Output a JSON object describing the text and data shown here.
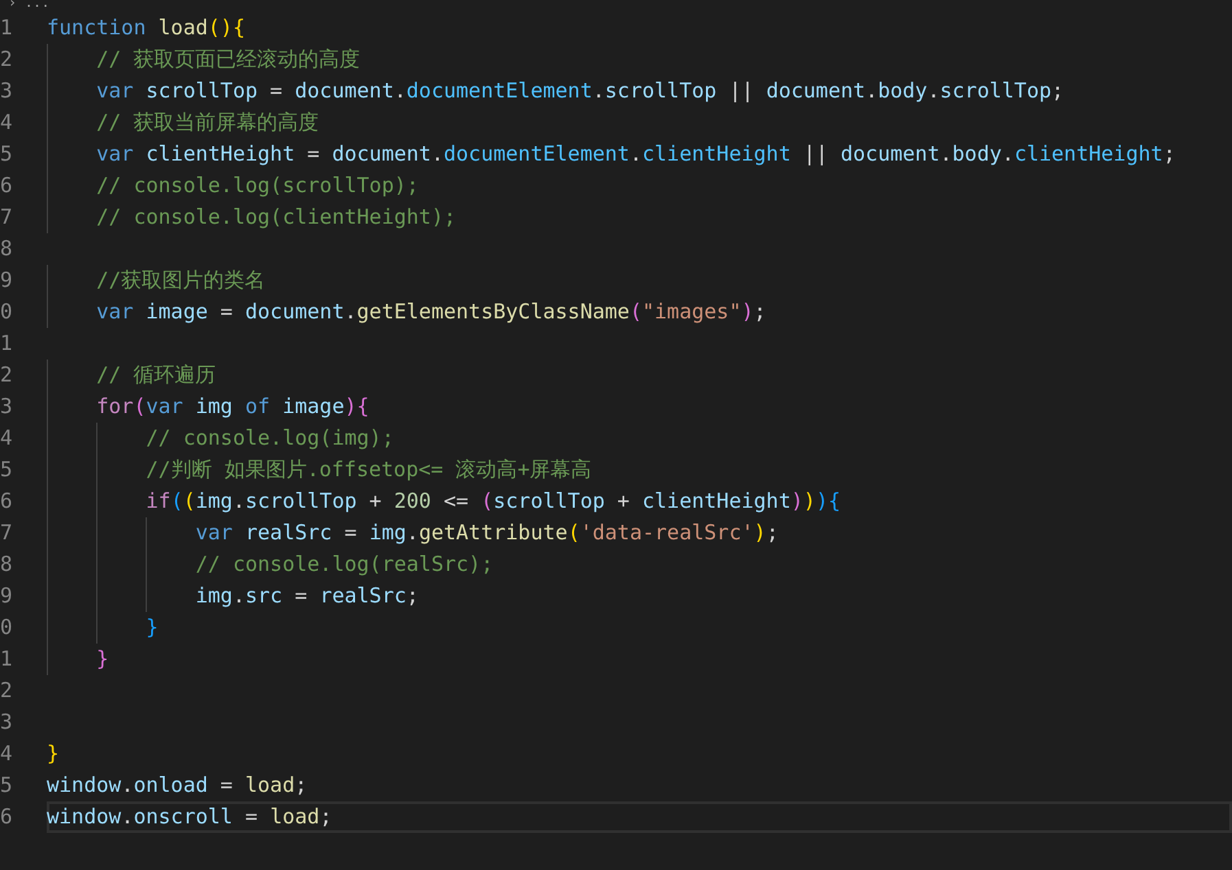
{
  "breadcrumb": "› ...",
  "lines": [
    {
      "number": "1",
      "current": false,
      "tokens": [
        {
          "kind": "kw",
          "text": "function "
        },
        {
          "kind": "fn",
          "text": "load"
        },
        {
          "kind": "b1",
          "text": "(){"
        }
      ]
    },
    {
      "number": "2",
      "current": false,
      "tokens": [
        {
          "kind": "comment",
          "text": "    // 获取页面已经滚动的高度"
        }
      ]
    },
    {
      "number": "3",
      "current": false,
      "tokens": [
        {
          "kind": "kw",
          "text": "    var "
        },
        {
          "kind": "var",
          "text": "scrollTop"
        },
        {
          "kind": "op",
          "text": " = "
        },
        {
          "kind": "var",
          "text": "document"
        },
        {
          "kind": "op",
          "text": "."
        },
        {
          "kind": "const",
          "text": "documentElement"
        },
        {
          "kind": "op",
          "text": "."
        },
        {
          "kind": "var",
          "text": "scrollTop"
        },
        {
          "kind": "op",
          "text": " || "
        },
        {
          "kind": "var",
          "text": "document"
        },
        {
          "kind": "op",
          "text": "."
        },
        {
          "kind": "var",
          "text": "body"
        },
        {
          "kind": "op",
          "text": "."
        },
        {
          "kind": "var",
          "text": "scrollTop"
        },
        {
          "kind": "op",
          "text": ";"
        }
      ]
    },
    {
      "number": "4",
      "current": false,
      "tokens": [
        {
          "kind": "comment",
          "text": "    // 获取当前屏幕的高度"
        }
      ]
    },
    {
      "number": "5",
      "current": false,
      "tokens": [
        {
          "kind": "kw",
          "text": "    var "
        },
        {
          "kind": "var",
          "text": "clientHeight"
        },
        {
          "kind": "op",
          "text": " = "
        },
        {
          "kind": "var",
          "text": "document"
        },
        {
          "kind": "op",
          "text": "."
        },
        {
          "kind": "const",
          "text": "documentElement"
        },
        {
          "kind": "op",
          "text": "."
        },
        {
          "kind": "const",
          "text": "clientHeight"
        },
        {
          "kind": "op",
          "text": " || "
        },
        {
          "kind": "var",
          "text": "document"
        },
        {
          "kind": "op",
          "text": "."
        },
        {
          "kind": "var",
          "text": "body"
        },
        {
          "kind": "op",
          "text": "."
        },
        {
          "kind": "const",
          "text": "clientHeight"
        },
        {
          "kind": "op",
          "text": ";"
        }
      ]
    },
    {
      "number": "6",
      "current": false,
      "tokens": [
        {
          "kind": "comment",
          "text": "    // console.log(scrollTop);"
        }
      ]
    },
    {
      "number": "7",
      "current": false,
      "tokens": [
        {
          "kind": "comment",
          "text": "    // console.log(clientHeight);"
        }
      ]
    },
    {
      "number": "8",
      "current": false
    },
    {
      "number": "9",
      "current": false,
      "tokens": [
        {
          "kind": "comment",
          "text": "    //获取图片的类名"
        }
      ]
    },
    {
      "number": "0",
      "current": false,
      "tokens": [
        {
          "kind": "kw",
          "text": "    var "
        },
        {
          "kind": "var",
          "text": "image"
        },
        {
          "kind": "op",
          "text": " = "
        },
        {
          "kind": "var",
          "text": "document"
        },
        {
          "kind": "op",
          "text": "."
        },
        {
          "kind": "fn",
          "text": "getElementsByClassName"
        },
        {
          "kind": "b2",
          "text": "("
        },
        {
          "kind": "str",
          "text": "\"images\""
        },
        {
          "kind": "b2",
          "text": ")"
        },
        {
          "kind": "op",
          "text": ";"
        }
      ]
    },
    {
      "number": "1",
      "current": false
    },
    {
      "number": "2",
      "current": false,
      "tokens": [
        {
          "kind": "comment",
          "text": "    // 循环遍历"
        }
      ]
    },
    {
      "number": "3",
      "current": false,
      "tokens": [
        {
          "kind": "ctrl",
          "text": "    for"
        },
        {
          "kind": "b2",
          "text": "("
        },
        {
          "kind": "kw",
          "text": "var "
        },
        {
          "kind": "var",
          "text": "img "
        },
        {
          "kind": "kw",
          "text": "of "
        },
        {
          "kind": "var",
          "text": "image"
        },
        {
          "kind": "b2",
          "text": "){"
        }
      ]
    },
    {
      "number": "4",
      "current": false,
      "tokens": [
        {
          "kind": "comment",
          "text": "        // console.log(img);"
        }
      ]
    },
    {
      "number": "5",
      "current": false,
      "tokens": [
        {
          "kind": "comment",
          "text": "        //判断 如果图片.offsetop<= 滚动高+屏幕高"
        }
      ]
    },
    {
      "number": "6",
      "current": false,
      "tokens": [
        {
          "kind": "ctrl",
          "text": "        if"
        },
        {
          "kind": "b3",
          "text": "("
        },
        {
          "kind": "b1",
          "text": "("
        },
        {
          "kind": "var",
          "text": "img"
        },
        {
          "kind": "op",
          "text": "."
        },
        {
          "kind": "var",
          "text": "scrollTop"
        },
        {
          "kind": "op",
          "text": " + "
        },
        {
          "kind": "num",
          "text": "200"
        },
        {
          "kind": "op",
          "text": " <= "
        },
        {
          "kind": "b2",
          "text": "("
        },
        {
          "kind": "var",
          "text": "scrollTop"
        },
        {
          "kind": "op",
          "text": " + "
        },
        {
          "kind": "var",
          "text": "clientHeight"
        },
        {
          "kind": "b2",
          "text": ")"
        },
        {
          "kind": "b1",
          "text": ")"
        },
        {
          "kind": "b3",
          "text": "){"
        }
      ]
    },
    {
      "number": "7",
      "current": false,
      "tokens": [
        {
          "kind": "kw",
          "text": "            var "
        },
        {
          "kind": "var",
          "text": "realSrc"
        },
        {
          "kind": "op",
          "text": " = "
        },
        {
          "kind": "var",
          "text": "img"
        },
        {
          "kind": "op",
          "text": "."
        },
        {
          "kind": "fn",
          "text": "getAttribute"
        },
        {
          "kind": "b1",
          "text": "("
        },
        {
          "kind": "str",
          "text": "'data-realSrc'"
        },
        {
          "kind": "b1",
          "text": ")"
        },
        {
          "kind": "op",
          "text": ";"
        }
      ]
    },
    {
      "number": "8",
      "current": false,
      "tokens": [
        {
          "kind": "comment",
          "text": "            // console.log(realSrc);"
        }
      ]
    },
    {
      "number": "9",
      "current": false,
      "tokens": [
        {
          "kind": "var",
          "text": "            img"
        },
        {
          "kind": "op",
          "text": "."
        },
        {
          "kind": "var",
          "text": "src"
        },
        {
          "kind": "op",
          "text": " = "
        },
        {
          "kind": "var",
          "text": "realSrc"
        },
        {
          "kind": "op",
          "text": ";"
        }
      ]
    },
    {
      "number": "0",
      "current": false,
      "tokens": [
        {
          "kind": "b3",
          "text": "        }"
        }
      ]
    },
    {
      "number": "1",
      "current": false,
      "tokens": [
        {
          "kind": "b2",
          "text": "    }"
        }
      ]
    },
    {
      "number": "2",
      "current": false
    },
    {
      "number": "3",
      "current": false
    },
    {
      "number": "4",
      "current": false,
      "tokens": [
        {
          "kind": "b1",
          "text": "}"
        }
      ]
    },
    {
      "number": "5",
      "current": false,
      "tokens": [
        {
          "kind": "var",
          "text": "window"
        },
        {
          "kind": "op",
          "text": "."
        },
        {
          "kind": "var",
          "text": "onload"
        },
        {
          "kind": "op",
          "text": " = "
        },
        {
          "kind": "fn",
          "text": "load"
        },
        {
          "kind": "op",
          "text": ";"
        }
      ]
    },
    {
      "number": "6",
      "current": true,
      "tokens": [
        {
          "kind": "var",
          "text": "window"
        },
        {
          "kind": "op",
          "text": "."
        },
        {
          "kind": "var",
          "text": "onscroll"
        },
        {
          "kind": "op",
          "text": " = "
        },
        {
          "kind": "fn",
          "text": "load"
        },
        {
          "kind": "op",
          "text": ";"
        }
      ]
    }
  ]
}
